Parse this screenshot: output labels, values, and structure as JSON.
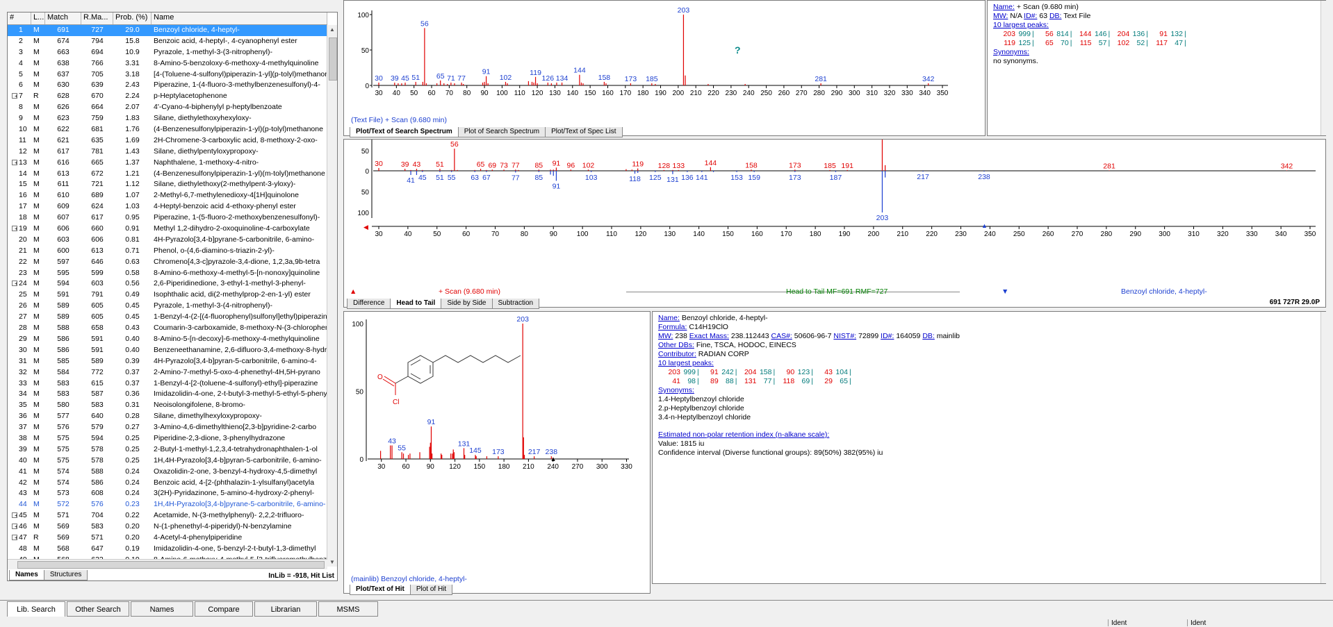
{
  "hitlist": {
    "columns": [
      "#",
      "L...",
      "Match",
      "R.Ma...",
      "Prob. (%)",
      "Name"
    ],
    "rows": [
      [
        "1",
        "M",
        "691",
        "727",
        "29.0",
        "Benzoyl chloride, 4-heptyl-"
      ],
      [
        "2",
        "M",
        "674",
        "794",
        "15.8",
        "Benzoic acid, 4-heptyl-, 4-cyanophenyl ester"
      ],
      [
        "3",
        "M",
        "663",
        "694",
        "10.9",
        "Pyrazole, 1-methyl-3-(3-nitrophenyl)-"
      ],
      [
        "4",
        "M",
        "638",
        "766",
        "3.31",
        "8-Amino-5-benzoloxy-6-methoxy-4-methylquinoline"
      ],
      [
        "5",
        "M",
        "637",
        "705",
        "3.18",
        "[4-(Toluene-4-sulfonyl)piperazin-1-yl](p-tolyl)methanone"
      ],
      [
        "6",
        "M",
        "630",
        "639",
        "2.43",
        "Piperazine, 1-(4-fluoro-3-methylbenzenesulfonyl)-4-"
      ],
      [
        "7",
        "R",
        "628",
        "670",
        "2.24",
        "p-Heptylacetophenone"
      ],
      [
        "8",
        "M",
        "626",
        "664",
        "2.07",
        "4'-Cyano-4-biphenylyl p-heptylbenzoate"
      ],
      [
        "9",
        "M",
        "623",
        "759",
        "1.83",
        "Silane, diethylethoxyhexyloxy-"
      ],
      [
        "10",
        "M",
        "622",
        "681",
        "1.76",
        "(4-Benzenesulfonylpiperazin-1-yl)(p-tolyl)methanone"
      ],
      [
        "11",
        "M",
        "621",
        "635",
        "1.69",
        "2H-Chromene-3-carboxylic acid, 8-methoxy-2-oxo-"
      ],
      [
        "12",
        "M",
        "617",
        "781",
        "1.43",
        "Silane, diethylpentyloxypropoxy-"
      ],
      [
        "13",
        "M",
        "616",
        "665",
        "1.37",
        "Naphthalene, 1-methoxy-4-nitro-"
      ],
      [
        "14",
        "M",
        "613",
        "672",
        "1.21",
        "(4-Benzenesulfonylpiperazin-1-yl)(m-tolyl)methanone"
      ],
      [
        "15",
        "M",
        "611",
        "721",
        "1.12",
        "Silane, diethylethoxy(2-methylpent-3-yloxy)-"
      ],
      [
        "16",
        "M",
        "610",
        "689",
        "1.07",
        "2-Methyl-6,7-methylenedioxy-4[1H]quinolone"
      ],
      [
        "17",
        "M",
        "609",
        "624",
        "1.03",
        "4-Heptyl-benzoic acid 4-ethoxy-phenyl ester"
      ],
      [
        "18",
        "M",
        "607",
        "617",
        "0.95",
        "Piperazine, 1-(5-fluoro-2-methoxybenzenesulfonyl)-"
      ],
      [
        "19",
        "M",
        "606",
        "660",
        "0.91",
        "Methyl 1,2-dihydro-2-oxoquinoline-4-carboxylate"
      ],
      [
        "20",
        "M",
        "603",
        "606",
        "0.81",
        "4H-Pyrazolo[3,4-b]pyrane-5-carbonitrile, 6-amino-"
      ],
      [
        "21",
        "M",
        "600",
        "613",
        "0.71",
        "Phenol, o-(4,6-diamino-s-triazin-2-yl)-"
      ],
      [
        "22",
        "M",
        "597",
        "646",
        "0.63",
        "Chromeno[4,3-c]pyrazole-3,4-dione, 1,2,3a,9b-tetra"
      ],
      [
        "23",
        "M",
        "595",
        "599",
        "0.58",
        "8-Amino-6-methoxy-4-methyl-5-[n-nonoxy]quinoline"
      ],
      [
        "24",
        "M",
        "594",
        "603",
        "0.56",
        "2,6-Piperidinedione, 3-ethyl-1-methyl-3-phenyl-"
      ],
      [
        "25",
        "M",
        "591",
        "791",
        "0.49",
        "Isophthalic acid, di(2-methylprop-2-en-1-yl) ester"
      ],
      [
        "26",
        "M",
        "589",
        "605",
        "0.45",
        "Pyrazole, 1-methyl-3-(4-nitrophenyl)-"
      ],
      [
        "27",
        "M",
        "589",
        "605",
        "0.45",
        "1-Benzyl-4-(2-[(4-fluorophenyl)sulfonyl]ethyl)piperazine"
      ],
      [
        "28",
        "M",
        "588",
        "658",
        "0.43",
        "Coumarin-3-carboxamide, 8-methoxy-N-(3-chlorophenyl)"
      ],
      [
        "29",
        "M",
        "586",
        "591",
        "0.40",
        "8-Amino-5-[n-decoxy]-6-methoxy-4-methylquinoline"
      ],
      [
        "30",
        "M",
        "586",
        "591",
        "0.40",
        "Benzeneethanamine, 2,6-difluoro-3,4-methoxy-8-hydroxy"
      ],
      [
        "31",
        "M",
        "585",
        "589",
        "0.39",
        "4H-Pyrazolo[3,4-b]pyran-5-carbonitrile, 6-amino-4-"
      ],
      [
        "32",
        "M",
        "584",
        "772",
        "0.37",
        "2-Amino-7-methyl-5-oxo-4-phenethyl-4H,5H-pyrano"
      ],
      [
        "33",
        "M",
        "583",
        "615",
        "0.37",
        "1-Benzyl-4-[2-(toluene-4-sulfonyl)-ethyl]-piperazine"
      ],
      [
        "34",
        "M",
        "583",
        "587",
        "0.36",
        "Imidazolidin-4-one, 2-t-butyl-3-methyl-5-ethyl-5-phenyl"
      ],
      [
        "35",
        "M",
        "580",
        "583",
        "0.31",
        "Neoisolongifolene, 8-bromo-"
      ],
      [
        "36",
        "M",
        "577",
        "640",
        "0.28",
        "Silane, dimethylhexyloxypropoxy-"
      ],
      [
        "37",
        "M",
        "576",
        "579",
        "0.27",
        "3-Amino-4,6-dimethylthieno[2,3-b]pyridine-2-carbo"
      ],
      [
        "38",
        "M",
        "575",
        "594",
        "0.25",
        "Piperidine-2,3-dione, 3-phenylhydrazone"
      ],
      [
        "39",
        "M",
        "575",
        "578",
        "0.25",
        "2-Butyl-1-methyl-1,2,3,4-tetrahydronaphthalen-1-ol"
      ],
      [
        "40",
        "M",
        "575",
        "578",
        "0.25",
        "1H,4H-Pyrazolo[3,4-b]pyran-5-carbonitrile, 6-amino-"
      ],
      [
        "41",
        "M",
        "574",
        "588",
        "0.24",
        "Oxazolidin-2-one, 3-benzyl-4-hydroxy-4,5-dimethyl"
      ],
      [
        "42",
        "M",
        "574",
        "586",
        "0.24",
        "Benzoic acid, 4-[2-(phthalazin-1-ylsulfanyl)acetyla"
      ],
      [
        "43",
        "M",
        "573",
        "608",
        "0.24",
        "3(2H)-Pyridazinone, 5-amino-4-hydroxy-2-phenyl-"
      ],
      [
        "44",
        "M",
        "572",
        "576",
        "0.23",
        "1H,4H-Pyrazolo[3,4-b]pyrane-5-carbonitrile, 6-amino-"
      ],
      [
        "45",
        "M",
        "571",
        "704",
        "0.22",
        "Acetamide, N-(3-methylphenyl)- 2,2,2-trifluoro-"
      ],
      [
        "46",
        "M",
        "569",
        "583",
        "0.20",
        "N-(1-phenethyl-4-piperidyl)-N-benzylamine"
      ],
      [
        "47",
        "R",
        "569",
        "571",
        "0.20",
        "4-Acetyl-4-phenylpiperidine"
      ],
      [
        "48",
        "M",
        "568",
        "647",
        "0.19",
        "Imidazolidin-4-one, 5-benzyl-2-t-butyl-1,3-dimethyl"
      ],
      [
        "49",
        "M",
        "568",
        "622",
        "0.19",
        "8-Amino-6-methoxy-4-methyl-5-[3-trifluoromethylbenzyl]"
      ]
    ],
    "tabs": [
      "Names",
      "Structures"
    ],
    "status": "InLib = -918, Hit List"
  },
  "search_plot": {
    "xticks": [
      "30",
      "40",
      "50",
      "60",
      "70",
      "80",
      "90",
      "100",
      "110",
      "120",
      "130",
      "140",
      "150",
      "160",
      "170",
      "180",
      "190",
      "200",
      "210",
      "220",
      "230",
      "240",
      "250",
      "260",
      "270",
      "280",
      "290",
      "300",
      "310",
      "320",
      "330",
      "340",
      "350"
    ],
    "yticks": [
      "100",
      "50",
      "0"
    ],
    "peak_labels": [
      "30",
      "39",
      "45",
      "51",
      "56",
      "65",
      "71",
      "77",
      "91",
      "102",
      "119",
      "126",
      "134",
      "144",
      "158",
      "173",
      "185",
      "203",
      "281",
      "342"
    ],
    "caption": "(Text File) + Scan (9.680 min)",
    "tabs": [
      "Plot/Text of Search Spectrum",
      "Plot of Search Spectrum",
      "Plot/Text of Spec List"
    ]
  },
  "search_info": {
    "name_label": "Name:",
    "name": "+ Scan (9.680 min)",
    "mw_label": "MW:",
    "mw": "N/A",
    "id_label": "ID#:",
    "id": "63",
    "db_label": "DB:",
    "db": "Text File",
    "peaks_label": "10 largest peaks:",
    "peaks_row1": [
      [
        "203",
        "999"
      ],
      [
        "56",
        "814"
      ],
      [
        "144",
        "146"
      ],
      [
        "204",
        "136"
      ],
      [
        "91",
        "132"
      ]
    ],
    "peaks_row2": [
      [
        "119",
        "125"
      ],
      [
        "65",
        "70"
      ],
      [
        "115",
        "57"
      ],
      [
        "102",
        "52"
      ],
      [
        "117",
        "47"
      ]
    ],
    "synonyms_label": "Synonyms:",
    "synonyms": "no synonyms."
  },
  "headtail_plot": {
    "yticks": [
      "100",
      "50",
      "0",
      "50",
      "100"
    ],
    "xticks": [
      "30",
      "40",
      "50",
      "60",
      "70",
      "80",
      "90",
      "100",
      "110",
      "120",
      "130",
      "140",
      "150",
      "160",
      "170",
      "180",
      "190",
      "200",
      "210",
      "220",
      "230",
      "240",
      "250",
      "260",
      "270",
      "280",
      "290",
      "300",
      "310",
      "320",
      "330",
      "340",
      "350"
    ],
    "top_labels": [
      "30",
      "39",
      "43",
      "51",
      "56",
      "65",
      "69",
      "73",
      "77",
      "85",
      "91",
      "96",
      "102",
      "119",
      "128",
      "133",
      "144",
      "158",
      "173",
      "185",
      "191",
      "203",
      "281",
      "342"
    ],
    "bottom_labels": [
      "41",
      "45",
      "51",
      "55",
      "63",
      "67",
      "77",
      "85",
      "91",
      "103",
      "118",
      "125",
      "131",
      "136",
      "141",
      "153",
      "159",
      "173",
      "187",
      "203",
      "217",
      "238"
    ],
    "status_left": "+ Scan (9.680 min)",
    "status_center": "Head to Tail MF=691 RMF=727",
    "status_right": "Benzoyl chloride, 4-heptyl-",
    "tabs": [
      "Difference",
      "Head to Tail",
      "Side by Side",
      "Subtraction"
    ],
    "score_line": "691 727R 29.0P"
  },
  "hit_plot": {
    "yticks": [
      "100",
      "50",
      "0"
    ],
    "xticks": [
      "30",
      "60",
      "90",
      "120",
      "150",
      "180",
      "210",
      "240",
      "270",
      "300",
      "330"
    ],
    "peak_labels": [
      "43",
      "55",
      "91",
      "131",
      "145",
      "173",
      "203",
      "217",
      "238"
    ],
    "caption": "(mainlib) Benzoyl chloride, 4-heptyl-",
    "tabs": [
      "Plot/Text of Hit",
      "Plot of Hit"
    ],
    "structure_label": "Cl"
  },
  "hit_info": {
    "name_label": "Name:",
    "name": "Benzoyl chloride, 4-heptyl-",
    "formula_label": "Formula:",
    "formula": "C14H19ClO",
    "mw_label": "MW:",
    "mw": "238",
    "exact_label": "Exact Mass:",
    "exact": "238.112443",
    "cas_label": "CAS#:",
    "cas": "50606-96-7",
    "nist_label": "NIST#:",
    "nist": "72899",
    "id_label": "ID#:",
    "id": "164059",
    "db_label": "DB:",
    "db": "mainlib",
    "otherdb_label": "Other DBs:",
    "otherdb": "Fine, TSCA, HODOC, EINECS",
    "contributor_label": "Contributor:",
    "contributor": "RADIAN CORP",
    "peaks_label": "10 largest peaks:",
    "peaks_row1": [
      [
        "203",
        "999"
      ],
      [
        "91",
        "242"
      ],
      [
        "204",
        "158"
      ],
      [
        "90",
        "123"
      ],
      [
        "43",
        "104"
      ]
    ],
    "peaks_row2": [
      [
        "41",
        "98"
      ],
      [
        "89",
        "88"
      ],
      [
        "131",
        "77"
      ],
      [
        "118",
        "69"
      ],
      [
        "29",
        "65"
      ]
    ],
    "synonyms_label": "Synonyms:",
    "synonyms": [
      "1.4-Heptylbenzoyl chloride",
      "2.p-Heptylbenzoyl chloride",
      "3.4-n-Heptylbenzoyl chloride"
    ],
    "ri_label": "Estimated non-polar retention index (n-alkane scale):",
    "ri_value": "Value: 1815 iu",
    "ri_ci": "Confidence interval (Diverse functional groups):  89(50%) 382(95%) iu"
  },
  "bottom_tabs": [
    "Lib. Search",
    "Other Search",
    "Names",
    "Compare",
    "Librarian",
    "MSMS"
  ],
  "statusbar": [
    "Ident",
    "Ident"
  ],
  "colors": {
    "red": "#e00000",
    "blue": "#1c3fd0",
    "teal": "#007a7a",
    "selected": "#3399ff"
  }
}
